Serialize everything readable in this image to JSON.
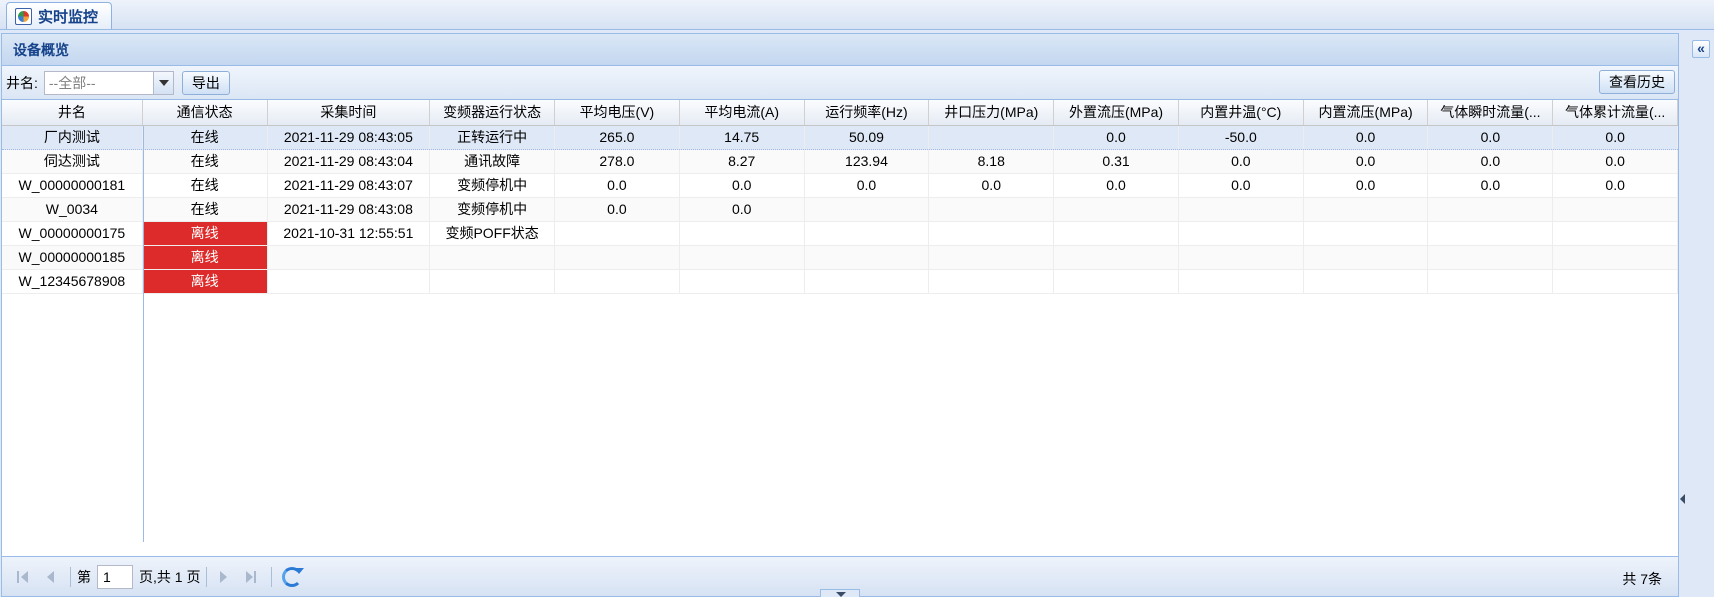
{
  "tab": {
    "label": "实时监控",
    "icon": "monitor-icon"
  },
  "panel": {
    "title": "设备概览"
  },
  "toolbar": {
    "well_label": "井名:",
    "well_combo_value": "--全部--",
    "export_label": "导出",
    "history_label": "查看历史"
  },
  "grid": {
    "columns": [
      "井名",
      "通信状态",
      "采集时间",
      "变频器运行状态",
      "平均电压(V)",
      "平均电流(A)",
      "运行频率(Hz)",
      "井口压力(MPa)",
      "外置流压(MPa)",
      "内置井温(°C)",
      "内置流压(MPa)",
      "气体瞬时流量(...",
      "气体累计流量(..."
    ],
    "rows": [
      [
        "厂内测试",
        "在线",
        "2021-11-29 08:43:05",
        "正转运行中",
        "265.0",
        "14.75",
        "50.09",
        "",
        "0.0",
        "-50.0",
        "0.0",
        "0.0",
        "0.0"
      ],
      [
        "伺达测试",
        "在线",
        "2021-11-29 08:43:04",
        "通讯故障",
        "278.0",
        "8.27",
        "123.94",
        "8.18",
        "0.31",
        "0.0",
        "0.0",
        "0.0",
        "0.0"
      ],
      [
        "W_00000000181",
        "在线",
        "2021-11-29 08:43:07",
        "变频停机中",
        "0.0",
        "0.0",
        "0.0",
        "0.0",
        "0.0",
        "0.0",
        "0.0",
        "0.0",
        "0.0"
      ],
      [
        "W_0034",
        "在线",
        "2021-11-29 08:43:08",
        "变频停机中",
        "0.0",
        "0.0",
        "",
        "",
        "",
        "",
        "",
        "",
        ""
      ],
      [
        "W_00000000175",
        "离线",
        "2021-10-31 12:55:51",
        "变频POFF状态",
        "",
        "",
        "",
        "",
        "",
        "",
        "",
        "",
        ""
      ],
      [
        "W_00000000185",
        "离线",
        "",
        "",
        "",
        "",
        "",
        "",
        "",
        "",
        "",
        "",
        ""
      ],
      [
        "W_12345678908",
        "离线",
        "",
        "",
        "",
        "",
        "",
        "",
        "",
        "",
        "",
        "",
        ""
      ]
    ],
    "offline_status": "离线",
    "offline_color": "#dd2a2a",
    "selected_row": 0
  },
  "pager": {
    "page_prefix": "第",
    "page_value": "1",
    "page_suffix": "页,共 1 页",
    "total": "共 7条"
  },
  "collapse_icon": "double-chevron-left-icon"
}
